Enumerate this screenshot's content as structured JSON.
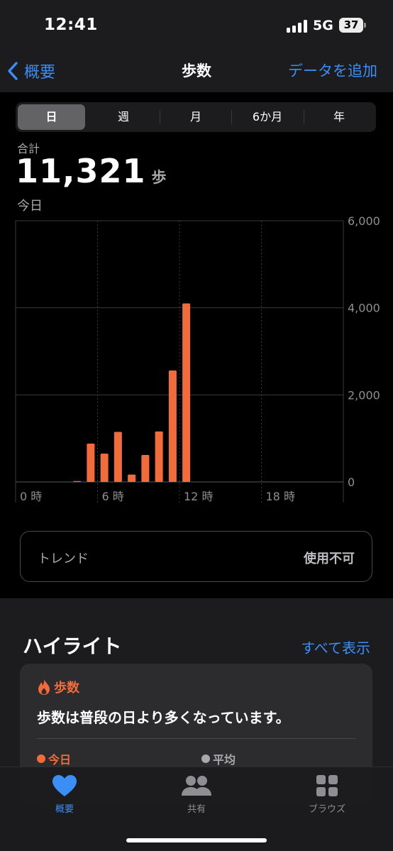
{
  "status": {
    "time": "12:41",
    "network": "5G",
    "battery": "37"
  },
  "nav": {
    "back_label": "概要",
    "title": "歩数",
    "action_label": "データを追加"
  },
  "segments": [
    "日",
    "週",
    "月",
    "6か月",
    "年"
  ],
  "selected_segment": "日",
  "summary": {
    "label": "合計",
    "value": "11,321",
    "unit": "歩",
    "date": "今日"
  },
  "colors": {
    "accent": "#3a8ef6",
    "bar": "#f26b3a",
    "background": "#000000",
    "surface": "#1c1c1e",
    "card": "#2c2c2e"
  },
  "chart_data": {
    "type": "bar",
    "x": [
      4,
      5,
      6,
      7,
      8,
      9,
      10,
      11,
      12
    ],
    "values": [
      20,
      880,
      650,
      1150,
      170,
      620,
      1160,
      2560,
      4100
    ],
    "x_ticks": [
      "0 時",
      "6 時",
      "12 時",
      "18 時"
    ],
    "x_tick_values": [
      0,
      6,
      12,
      18
    ],
    "xlim": [
      0,
      24
    ],
    "y_ticks": [
      "6,000",
      "4,000",
      "2,000",
      "0"
    ],
    "y_tick_values": [
      6000,
      4000,
      2000,
      0
    ],
    "ylim": [
      0,
      6000
    ],
    "grid": true,
    "bar_color": "#f26b3a"
  },
  "trend": {
    "label": "トレンド",
    "value": "使用不可"
  },
  "highlights": {
    "title": "ハイライト",
    "see_all": "すべて表示",
    "card": {
      "category": "歩数",
      "text": "歩数は普段の日より多くなっています。",
      "legend": [
        "今日",
        "平均"
      ]
    }
  },
  "tabs": [
    {
      "label": "概要",
      "icon": "heart-icon"
    },
    {
      "label": "共有",
      "icon": "people-icon"
    },
    {
      "label": "ブラウズ",
      "icon": "grid-icon"
    }
  ]
}
